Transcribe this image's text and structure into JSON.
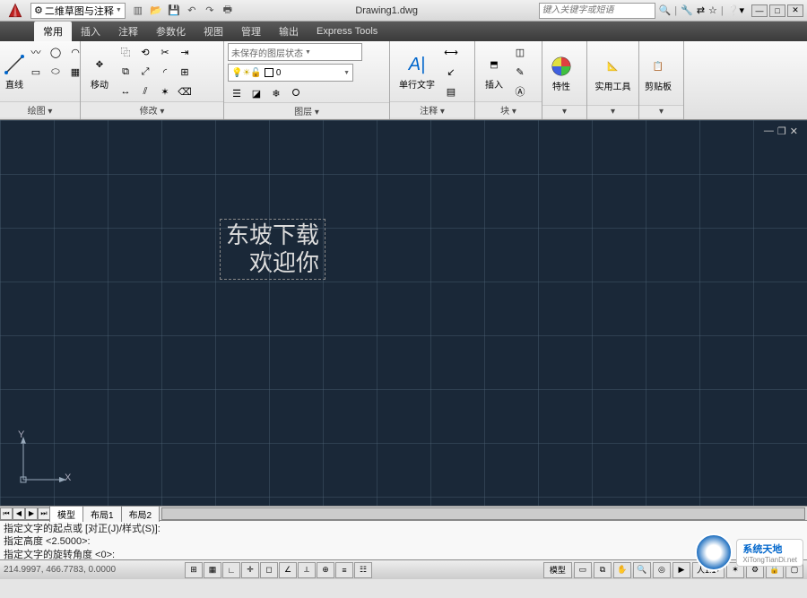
{
  "title": "Drawing1.dwg",
  "workspace": "二维草图与注释",
  "search_placeholder": "键入关键字或短语",
  "menu": {
    "items": [
      "常用",
      "插入",
      "注释",
      "参数化",
      "视图",
      "管理",
      "输出",
      "Express Tools"
    ]
  },
  "ribbon": {
    "draw": {
      "title": "绘图",
      "line": "直线"
    },
    "modify": {
      "title": "修改",
      "move": "移动"
    },
    "layer": {
      "title": "图层",
      "unsaved": "未保存的图层状态",
      "current": "0"
    },
    "annot": {
      "title": "注释",
      "text": "单行文字"
    },
    "block": {
      "title": "块",
      "insert": "插入"
    },
    "prop": {
      "title": "特性"
    },
    "util": {
      "title": "实用工具"
    },
    "clip": {
      "title": "剪贴板"
    }
  },
  "canvas": {
    "text_line1": "东坡下载",
    "text_line2": "欢迎你",
    "axis_x": "X",
    "axis_y": "Y"
  },
  "tabs": {
    "model": "模型",
    "layout1": "布局1",
    "layout2": "布局2"
  },
  "cmd": {
    "l1": "指定文字的起点或 [对正(J)/样式(S)]:",
    "l2": "指定高度 <2.5000>:",
    "l3": "指定文字的旋转角度 <0>:"
  },
  "status": {
    "coords": "214.9997, 466.7783, 0.0000",
    "model": "模型",
    "scale": "1:1",
    "anno": "人"
  },
  "watermark": {
    "brand": "系统天地",
    "url": "XiTongTianDi.net"
  }
}
